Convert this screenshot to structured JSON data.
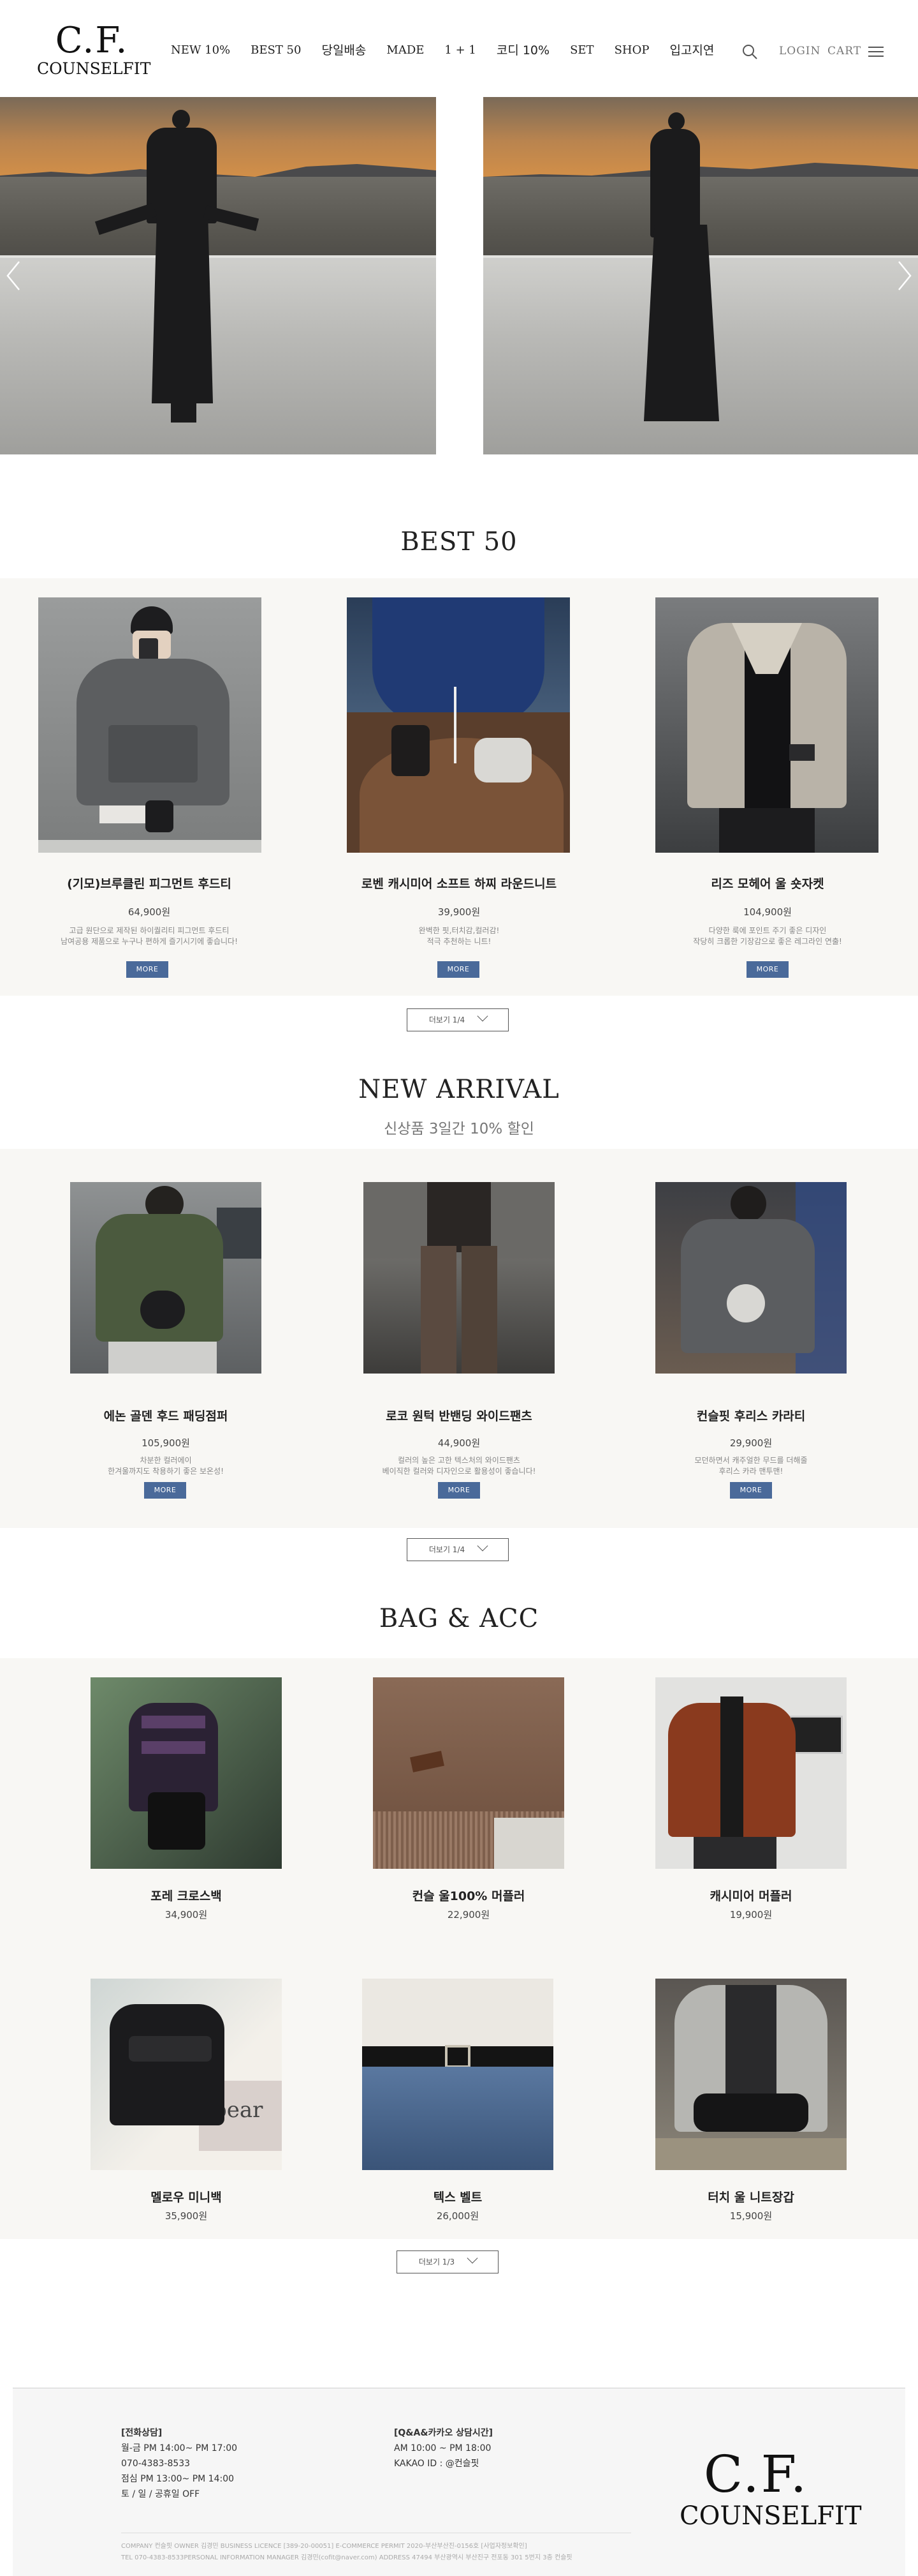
{
  "brand": {
    "logo_main": "C.F.",
    "logo_sub": "COUNSELFIT"
  },
  "nav": {
    "items": [
      "NEW 10%",
      "BEST 50",
      "당일배송",
      "MADE",
      "1 + 1",
      "코디 10%",
      "SET",
      "SHOP",
      "입고지연"
    ],
    "login": "LOGIN",
    "cart": "CART"
  },
  "best": {
    "title": "BEST  50",
    "products": [
      {
        "name": "(기모)브루클린 피그먼트 후드티",
        "price": "64,900원",
        "desc1": "고급 원단으로 제작된 하이퀄리티 피그먼트 후드티",
        "desc2": "남여공용 제품으로 누구나 편하게 즐기시기에 좋습니다!",
        "more": "MORE"
      },
      {
        "name": "로벤 캐시미어 소프트 하찌 라운드니트",
        "price": "39,900원",
        "desc1": "완벽한 핏,터치감,컬러감!",
        "desc2": "적극 추천하는 니트!",
        "more": "MORE"
      },
      {
        "name": "리즈 모헤어 울 숏자켓",
        "price": "104,900원",
        "desc1": "다양한 룩에 포인트 주기 좋은 디자인",
        "desc2": "작당히 크롭한 기장감으로 좋은 레그라인 연출!",
        "more": "MORE"
      }
    ],
    "more_bar": "더보기   1/4"
  },
  "new_arrival": {
    "title": "NEW ARRIVAL",
    "subtitle": "신상품 3일간 10% 할인",
    "products": [
      {
        "name": "에논 골덴 후드 패딩점퍼",
        "price": "105,900원",
        "desc1": "차분한 컬러에이",
        "desc2": "한겨울까지도 착용하기 좋은 보온성!",
        "more": "MORE"
      },
      {
        "name": "로코 원턱 반밴딩 와이드팬츠",
        "price": "44,900원",
        "desc1": "컬러의 높은 고한 텍스처의 와이드팬츠",
        "desc2": "베이직한 컬러와 디자인으로 활용성이 좋습니다!",
        "more": "MORE"
      },
      {
        "name": "컨슬핏 후리스 카라티",
        "price": "29,900원",
        "desc1": "모던하면서 캐주얼한 무드를 더해줄",
        "desc2": "후리스 카라 맨투맨!",
        "more": "MORE"
      }
    ],
    "more_bar": "더보기   1/4"
  },
  "bag_acc": {
    "title": "BAG & ACC",
    "products": [
      {
        "name": "포레 크로스백",
        "price": "34,900원"
      },
      {
        "name": "컨슬 울100% 머플러",
        "price": "22,900원"
      },
      {
        "name": "캐시미어 머플러",
        "price": "19,900원"
      },
      {
        "name": "멜로우 미니백",
        "price": "35,900원"
      },
      {
        "name": "텍스 벨트",
        "price": "26,000원"
      },
      {
        "name": "터치 울 니트장갑",
        "price": "15,900원"
      }
    ],
    "bag_label": "bear",
    "more_bar": "더보기   1/3"
  },
  "footer": {
    "cs_title": "[전화상담]",
    "cs_lines": [
      "월-금 PM 14:00~ PM 17:00",
      "070-4383-8533",
      "점심 PM 13:00~ PM 14:00",
      "토 / 일 / 공휴일 OFF"
    ],
    "kakao_title": "[Q&A&카카오 상담시간]",
    "kakao_lines": [
      "AM 10:00 ~ PM 18:00",
      "KAKAO ID : @컨슬핏"
    ],
    "info1": "COMPANY 컨슬핏 OWNER 김경민 BUSINESS LICENCE [389-20-00051] E-COMMERCE PERMIT 2020-부산부산진-0156호 [사업자정보확인]",
    "info2": "TEL 070-4383-8533PERSONAL INFORMATION MANAGER 김경민(cofit@naver.com) ADDRESS 47494 부산광역시 부산진구 전포동 301 5번지 3층 컨슬핏",
    "logo_main": "C.F.",
    "logo_sub": "COUNSELFIT"
  },
  "colors": {
    "more_button": "#4a6a9a",
    "band": "#f8f7f4",
    "footer_bg": "#f6f6f6"
  }
}
